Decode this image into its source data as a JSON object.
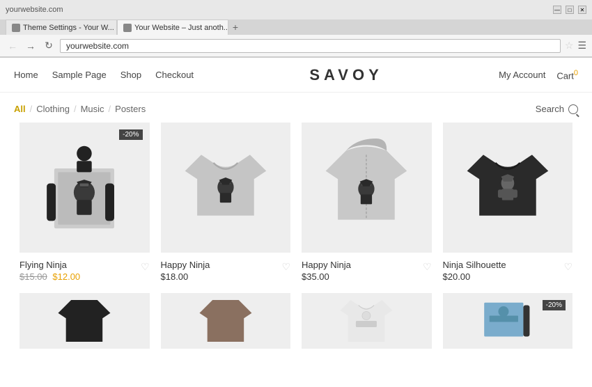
{
  "browser": {
    "tabs": [
      {
        "label": "Theme Settings - Your W...",
        "active": false
      },
      {
        "label": "Your Website – Just anoth...",
        "active": true
      }
    ],
    "url": "yourwebsite.com",
    "new_tab_label": "+"
  },
  "nav": {
    "links": [
      "Home",
      "Sample Page",
      "Shop",
      "Checkout"
    ],
    "logo": "SAVOY",
    "right_links": [
      "My Account"
    ],
    "cart_label": "Cart",
    "cart_count": "0"
  },
  "categories": {
    "all": "All",
    "items": [
      "Clothing",
      "Music",
      "Posters"
    ],
    "search_label": "Search"
  },
  "products": [
    {
      "name": "Flying Ninja",
      "price_old": "$15.00",
      "price_new": "$12.00",
      "has_discount": true,
      "discount_label": "-20%",
      "type": "poster"
    },
    {
      "name": "Happy Ninja",
      "price": "$18.00",
      "has_discount": false,
      "type": "tshirt-gray"
    },
    {
      "name": "Happy Ninja",
      "price": "$35.00",
      "has_discount": false,
      "type": "hoodie-gray"
    },
    {
      "name": "Ninja Silhouette",
      "price": "$20.00",
      "has_discount": false,
      "type": "tshirt-black"
    },
    {
      "name": "",
      "price": "",
      "has_discount": false,
      "type": "hoodie-black"
    },
    {
      "name": "",
      "price": "",
      "has_discount": false,
      "type": "hoodie-brown"
    },
    {
      "name": "",
      "price": "",
      "has_discount": false,
      "type": "tshirt-white"
    },
    {
      "name": "",
      "price": "",
      "has_discount": true,
      "discount_label": "-20%",
      "type": "poster-blue"
    }
  ]
}
